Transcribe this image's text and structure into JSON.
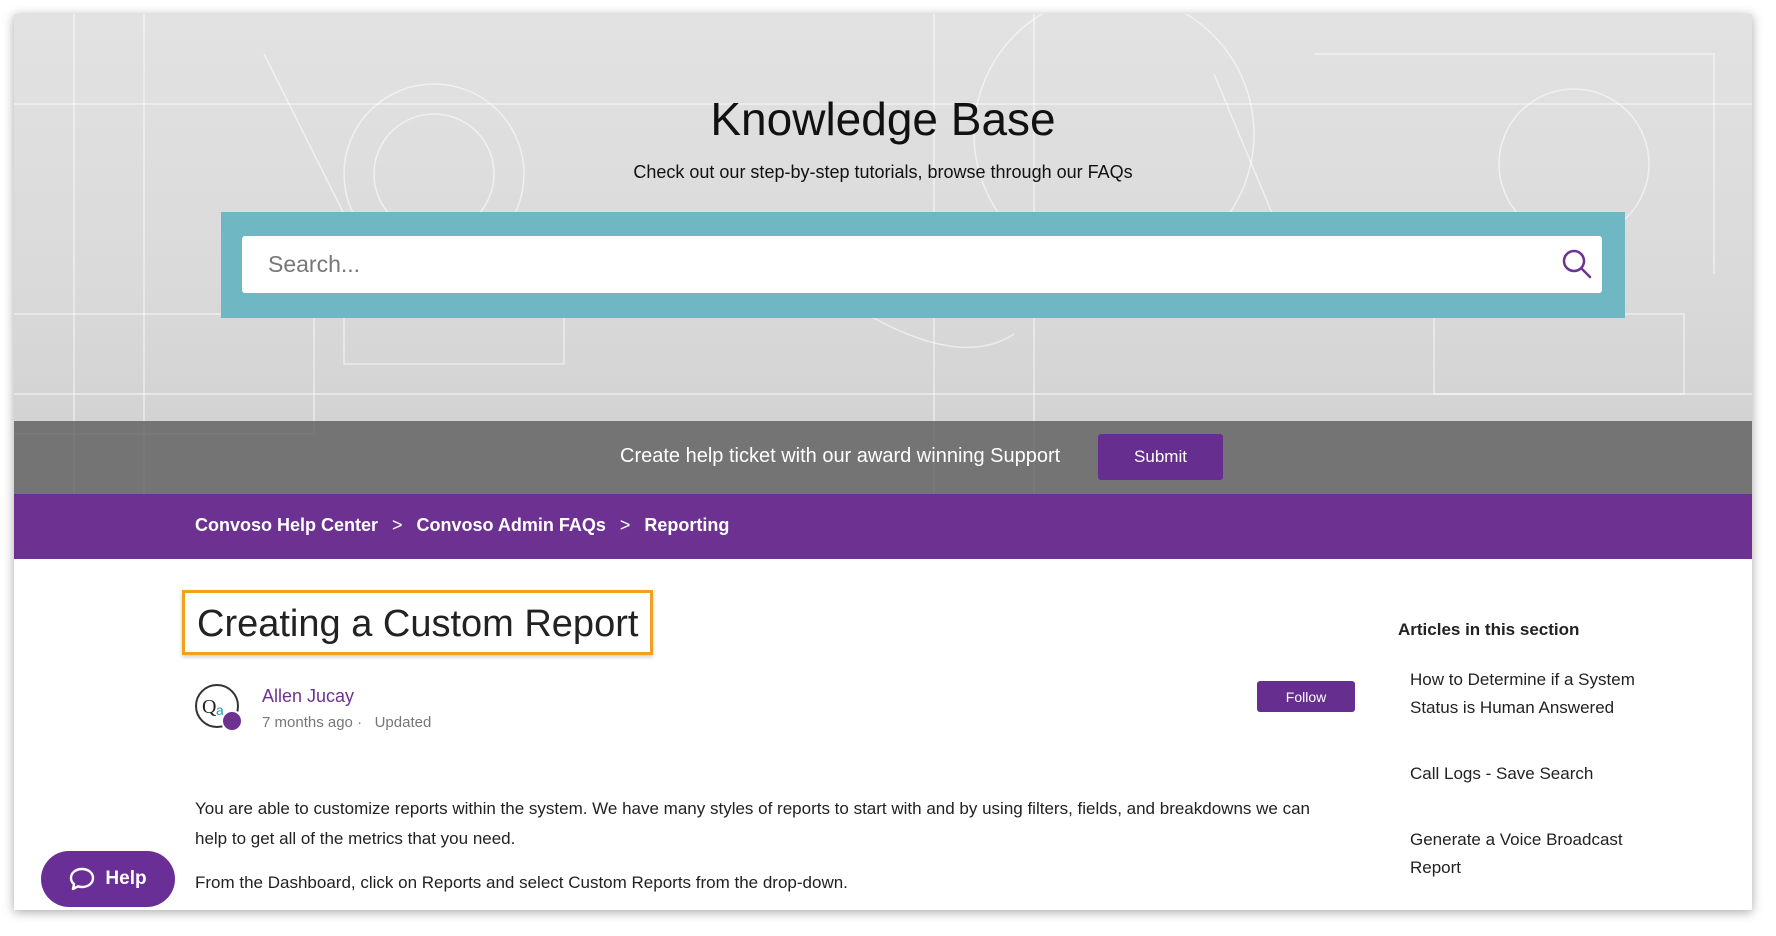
{
  "hero": {
    "title": "Knowledge Base",
    "subtitle": "Check out our step-by-step tutorials, browse through our FAQs"
  },
  "search": {
    "placeholder": "Search...",
    "value": ""
  },
  "ticket": {
    "text": "Create help ticket with our award winning Support",
    "button_label": "Submit"
  },
  "breadcrumb": {
    "items": [
      "Convoso Help Center",
      "Convoso Admin FAQs",
      "Reporting"
    ],
    "separator": ">"
  },
  "article": {
    "title": "Creating a Custom Report",
    "author": "Allen Jucay",
    "time_ago": "7 months ago",
    "dot": "·",
    "status": "Updated",
    "follow_label": "Follow",
    "paragraphs": [
      "You are able to customize reports within the system.  We have many styles of reports to start with and by using filters, fields, and breakdowns we can help to get all of the metrics that you need.",
      "From the Dashboard, click on Reports and select Custom Reports from the drop-down."
    ]
  },
  "sidebar": {
    "heading": "Articles in this section",
    "articles": [
      "How to Determine if a System Status is Human Answered",
      "Call Logs - Save Search",
      "Generate a Voice Broadcast Report"
    ]
  },
  "help_widget": {
    "label": "Help",
    "icon": "chat-bubble-icon"
  },
  "colors": {
    "brand_purple": "#6d3291",
    "search_band": "#6fb7c2",
    "highlight": "#f0a21c"
  }
}
